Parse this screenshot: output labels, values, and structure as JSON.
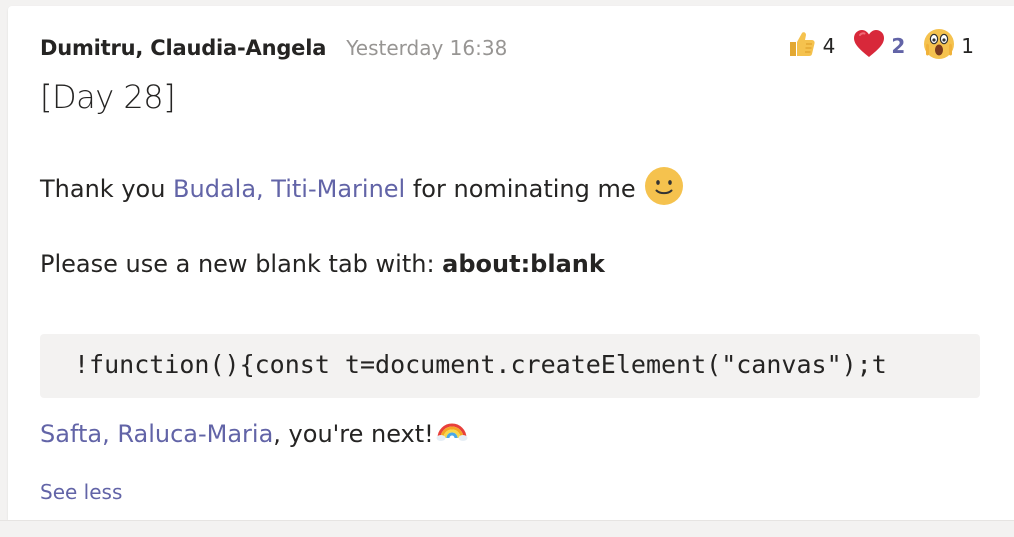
{
  "message": {
    "author": "Dumitru, Claudia-Angela",
    "timestamp": "Yesterday 16:38",
    "title": "[Day 28]",
    "line1": {
      "prefix": "Thank you ",
      "mention": "Budala, Titi-Marinel",
      "suffix": " for nominating me",
      "emoji": "smile-emoji"
    },
    "line2": {
      "prefix": "Please use a new blank tab with: ",
      "bold": "about:blank"
    },
    "code": "!function(){const t=document.createElement(\"canvas\");t",
    "line3": {
      "mention": "Safta, Raluca-Maria",
      "suffix": ", you're next!",
      "emoji": "rainbow-emoji"
    },
    "see_less": "See less"
  },
  "reactions": [
    {
      "icon": "like-icon",
      "count": "4"
    },
    {
      "icon": "heart-icon",
      "count": "2",
      "mine": true
    },
    {
      "icon": "surprised-icon",
      "count": "1"
    }
  ],
  "colors": {
    "accent": "#6264a7",
    "heart": "#d8283a",
    "like": "#f2c04b",
    "code_bg": "#f3f2f1"
  }
}
